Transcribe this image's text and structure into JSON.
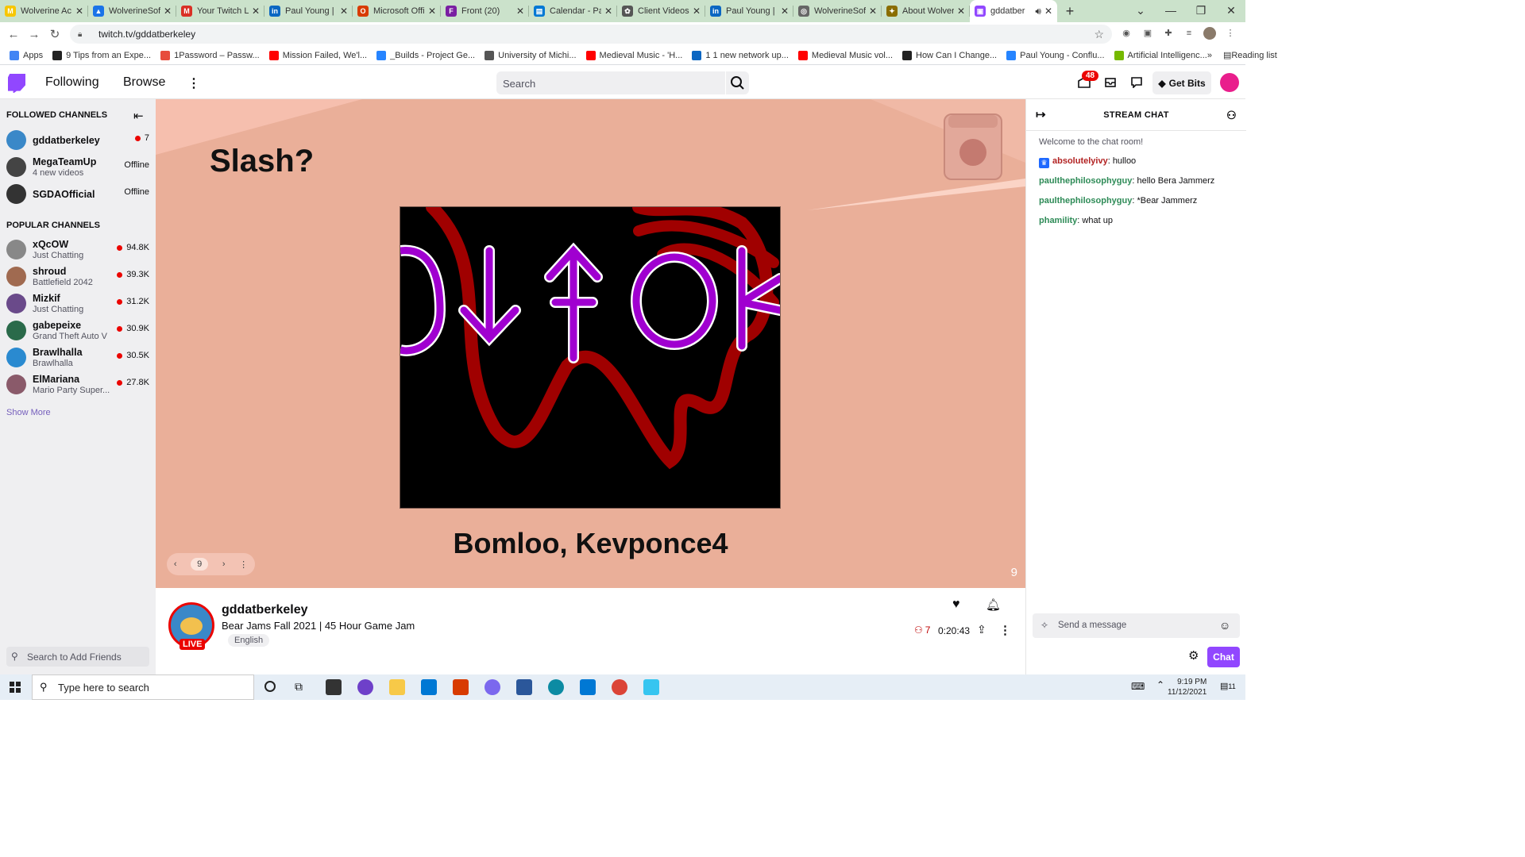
{
  "browser": {
    "tabs": [
      {
        "title": "Wolverine Ac",
        "color": "#f7c600",
        "glyph": "M"
      },
      {
        "title": "WolverineSof",
        "color": "#1a73e8",
        "glyph": "▲"
      },
      {
        "title": "Your Twitch L",
        "color": "#d93025",
        "glyph": "M"
      },
      {
        "title": "Paul Young | L",
        "color": "#0a66c2",
        "glyph": "in"
      },
      {
        "title": "Microsoft Offi",
        "color": "#d83b01",
        "glyph": "O"
      },
      {
        "title": "Front (20)",
        "color": "#7a1fa2",
        "glyph": "F"
      },
      {
        "title": "Calendar - Pa",
        "color": "#0078d4",
        "glyph": "▤"
      },
      {
        "title": "Client Videos",
        "color": "#555555",
        "glyph": "✿"
      },
      {
        "title": "Paul Young | L",
        "color": "#0a66c2",
        "glyph": "in"
      },
      {
        "title": "WolverineSof",
        "color": "#666666",
        "glyph": "◎"
      },
      {
        "title": "About Wolver",
        "color": "#8a6d00",
        "glyph": "✦"
      },
      {
        "title": "gddatber",
        "color": "#9147ff",
        "glyph": "▣",
        "active": true
      }
    ],
    "url": "twitch.tv/gddatberkeley",
    "bookmarks": [
      {
        "label": "Apps",
        "color": "#4285f4"
      },
      {
        "label": "9 Tips from an Expe...",
        "color": "#222222"
      },
      {
        "label": "1Password – Passw...",
        "color": "#e74c3c"
      },
      {
        "label": "Mission Failed, We'l...",
        "color": "#ff0000"
      },
      {
        "label": "_Builds - Project Ge...",
        "color": "#2684ff"
      },
      {
        "label": "University of Michi...",
        "color": "#555555"
      },
      {
        "label": "Medieval Music - 'H...",
        "color": "#ff0000"
      },
      {
        "label": "1 1 new network up...",
        "color": "#0a66c2"
      },
      {
        "label": "Medieval Music vol...",
        "color": "#ff0000"
      },
      {
        "label": "How Can I Change...",
        "color": "#222222"
      },
      {
        "label": "Paul Young - Conflu...",
        "color": "#2684ff"
      },
      {
        "label": "Artificial Intelligenc...",
        "color": "#76b900"
      }
    ],
    "reading_list": "Reading list"
  },
  "twitch": {
    "nav": {
      "following": "Following",
      "browse": "Browse",
      "search_placeholder": "Search",
      "notifications": "48",
      "get_bits": "Get Bits"
    },
    "sidebar": {
      "followed_header": "FOLLOWED CHANNELS",
      "followed": [
        {
          "name": "gddatberkeley",
          "sub": "",
          "viewers": "7",
          "live": true,
          "color": "#3a88c8"
        },
        {
          "name": "MegaTeamUp",
          "sub": "4 new videos",
          "viewers": "Offline",
          "live": false,
          "color": "#444444"
        },
        {
          "name": "SGDAOfficial",
          "sub": "",
          "viewers": "Offline",
          "live": false,
          "color": "#333333"
        }
      ],
      "popular_header": "POPULAR CHANNELS",
      "popular": [
        {
          "name": "xQcOW",
          "sub": "Just Chatting",
          "viewers": "94.8K",
          "color": "#888888"
        },
        {
          "name": "shroud",
          "sub": "Battlefield 2042",
          "viewers": "39.3K",
          "color": "#a06a50"
        },
        {
          "name": "Mizkif",
          "sub": "Just Chatting",
          "viewers": "31.2K",
          "color": "#6a4a8a"
        },
        {
          "name": "gabepeixe",
          "sub": "Grand Theft Auto V",
          "viewers": "30.9K",
          "color": "#2a6a4a"
        },
        {
          "name": "Brawlhalla",
          "sub": "Brawlhalla",
          "viewers": "30.5K",
          "color": "#2a8ad0"
        },
        {
          "name": "ElMariana",
          "sub": "Mario Party Super...",
          "viewers": "27.8K",
          "color": "#8a5a6a"
        }
      ],
      "show_more": "Show More",
      "search_friends": "Search to Add Friends"
    },
    "player": {
      "slide_title": "Slash?",
      "slide_caption": "Bomloo, Kevponce4",
      "slide_number": "9",
      "pager_value": "9"
    },
    "channel": {
      "name": "gddatberkeley",
      "title": "Bear Jams Fall 2021 | 45 Hour Game Jam",
      "tag": "English",
      "live_badge": "LIVE",
      "viewers": "7",
      "uptime": "0:20:43"
    },
    "chat": {
      "header": "STREAM CHAT",
      "welcome": "Welcome to the chat room!",
      "messages": [
        {
          "user": "absolutelyivy",
          "text": ": hulloo",
          "color": "#b22222",
          "badge": true
        },
        {
          "user": "paulthephilosophyguy",
          "text": ": hello Bera Jammerz",
          "color": "#2e8b57",
          "badge": false
        },
        {
          "user": "paulthephilosophyguy",
          "text": ": *Bear Jammerz",
          "color": "#2e8b57",
          "badge": false
        },
        {
          "user": "phamility",
          "text": ": what up",
          "color": "#2e8b57",
          "badge": false
        }
      ],
      "input_placeholder": "Send a message",
      "chat_button": "Chat"
    }
  },
  "taskbar": {
    "search_placeholder": "Type here to search",
    "time": "9:19 PM",
    "date": "11/12/2021",
    "notif_count": "11"
  }
}
